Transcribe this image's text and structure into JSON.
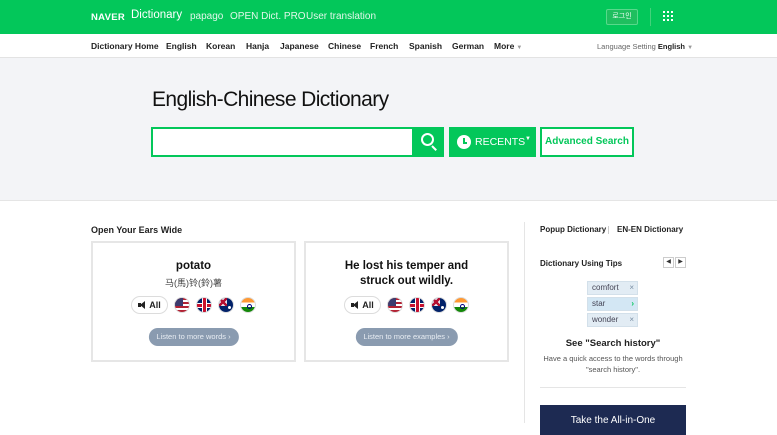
{
  "topbar": {
    "logo": "NAVER",
    "dictionary": "Dictionary",
    "links": [
      "papago",
      "OPEN Dict. PRO",
      "User translation"
    ],
    "login": "로그인"
  },
  "nav": {
    "items": [
      "Dictionary Home",
      "English",
      "Korean",
      "Hanja",
      "Japanese",
      "Chinese",
      "French",
      "Spanish",
      "German",
      "More"
    ],
    "language_setting_label": "Language Setting",
    "language_setting_value": "English"
  },
  "hero": {
    "title": "English-Chinese Dictionary",
    "search_value": "",
    "recents_label": "RECENTS",
    "advanced_search_label": "Advanced Search"
  },
  "main": {
    "section_title": "Open Your Ears Wide",
    "cards": [
      {
        "word": "potato",
        "sub": "马(馬)铃(鈴)薯",
        "all_label": "All",
        "listen_label": "Listen to more words"
      },
      {
        "word": "He lost his temper and struck out wildly.",
        "all_label": "All",
        "listen_label": "Listen to more examples"
      }
    ]
  },
  "right": {
    "popup_dictionary": "Popup Dictionary",
    "en_en_dictionary": "EN-EN Dictionary",
    "tips_title": "Dictionary Using Tips",
    "tip_words": [
      "comfort",
      "star",
      "wonder"
    ],
    "tip_heading": "See \"Search history\"",
    "tip_text": "Have a quick access to the words through \"search history\".",
    "banner_text": "Take the All-in-One"
  },
  "colors": {
    "brand_green": "#03c75a",
    "banner_navy": "#1d2a52"
  },
  "icons": [
    "search-icon",
    "clock-icon",
    "caret-down-icon",
    "apps-grid-icon",
    "speaker-icon",
    "us-flag-icon",
    "uk-flag-icon",
    "au-flag-icon",
    "in-flag-icon",
    "chevron-left-icon",
    "chevron-right-icon",
    "close-icon"
  ]
}
